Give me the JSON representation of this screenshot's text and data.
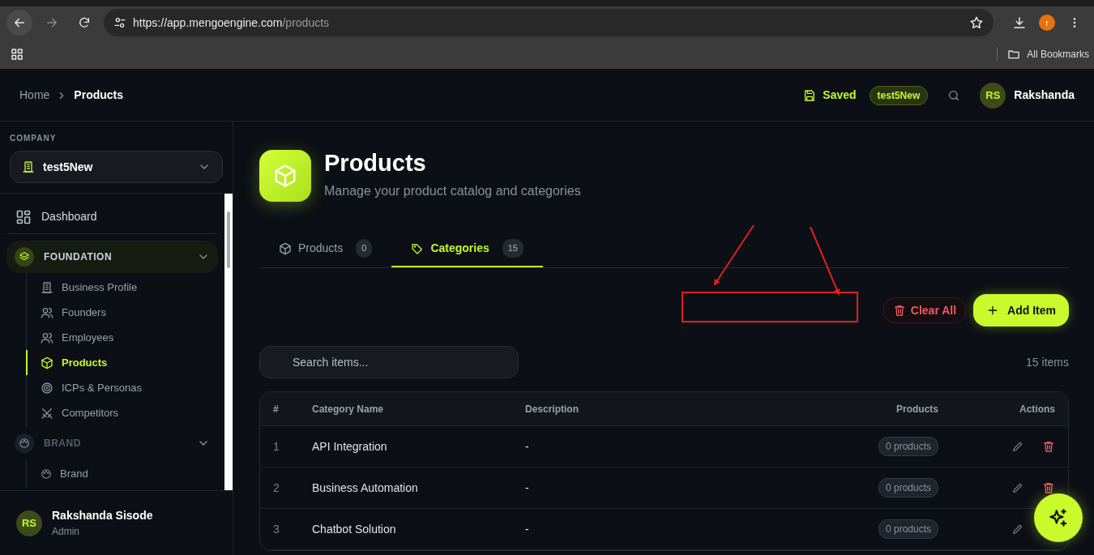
{
  "browser": {
    "url_host": "https://app.mengoengine.com",
    "url_path": "/products",
    "profile_initial": "r",
    "bookmarks_label": "All Bookmarks"
  },
  "header": {
    "breadcrumbs": [
      {
        "label": "Home",
        "current": false
      },
      {
        "label": "Products",
        "current": true
      }
    ],
    "saved_label": "Saved",
    "workspace_badge": "test5New",
    "user": {
      "initials": "RS",
      "name": "Rakshanda"
    }
  },
  "sidebar": {
    "company_label": "COMPANY",
    "company": "test5New",
    "nav": [
      {
        "kind": "item",
        "label": "Dashboard",
        "selected": false
      },
      {
        "kind": "group",
        "label": "FOUNDATION",
        "active": true,
        "expanded": true,
        "children": [
          {
            "label": "Business Profile",
            "selected": false
          },
          {
            "label": "Founders",
            "selected": false
          },
          {
            "label": "Employees",
            "selected": false
          },
          {
            "label": "Products",
            "selected": true
          },
          {
            "label": "ICPs & Personas",
            "selected": false
          },
          {
            "label": "Competitors",
            "selected": false
          }
        ]
      },
      {
        "kind": "group",
        "label": "BRAND",
        "active": false,
        "expanded": true,
        "children": [
          {
            "label": "Brand",
            "selected": false
          }
        ]
      }
    ],
    "user": {
      "initials": "RS",
      "name": "Rakshanda Sisode",
      "role": "Admin"
    }
  },
  "page": {
    "title": "Products",
    "subtitle": "Manage your product catalog and categories",
    "tabs": [
      {
        "label": "Products",
        "count": "0",
        "selected": false
      },
      {
        "label": "Categories",
        "count": "15",
        "selected": true
      }
    ],
    "clear_label": "Clear All",
    "add_label": "Add Item",
    "search": {
      "placeholder": "Search items..."
    },
    "item_count": "15 items",
    "table": {
      "columns": [
        "#",
        "Category Name",
        "Description",
        "Products",
        "Actions"
      ],
      "rows": [
        {
          "number": "1",
          "name": "API Integration",
          "description": "-",
          "products": "0 products"
        },
        {
          "number": "2",
          "name": "Business Automation",
          "description": "-",
          "products": "0 products"
        },
        {
          "number": "3",
          "name": "Chatbot Solution",
          "description": "-",
          "products": "0 products"
        }
      ]
    }
  },
  "annotations": [
    {
      "kind": "arrow"
    },
    {
      "kind": "arrow"
    },
    {
      "kind": "rectangle"
    }
  ]
}
